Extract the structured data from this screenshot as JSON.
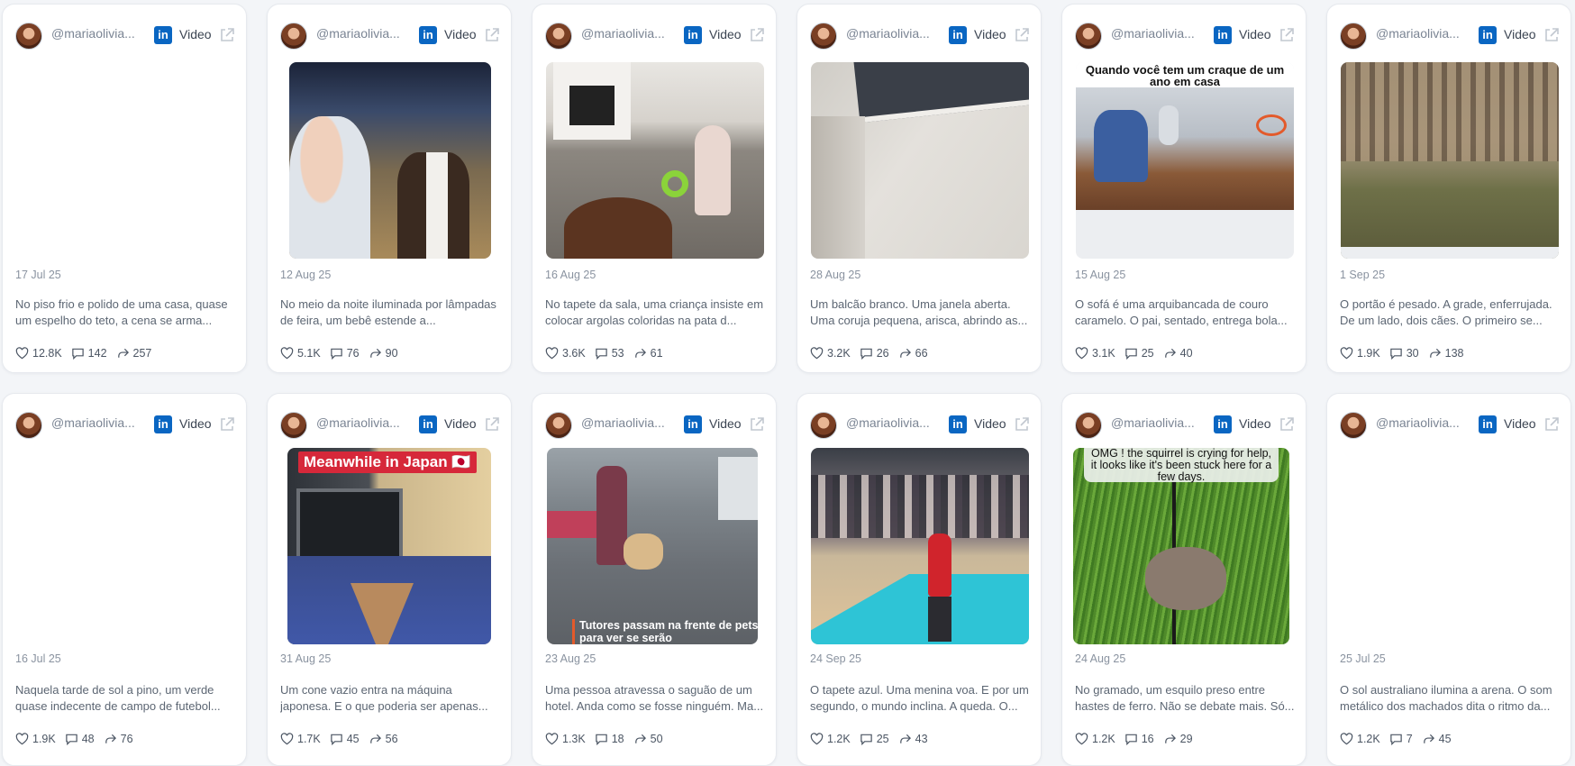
{
  "cards": [
    {
      "handle": "@mariaolivia...",
      "network": "in",
      "kind": "Video",
      "date": "17 Jul 25",
      "desc": "No piso frio e polido de uma casa, quase um espelho do teto, a cena se arma...",
      "likes": "12.8K",
      "comments": "142",
      "shares": "257"
    },
    {
      "handle": "@mariaolivia...",
      "network": "in",
      "kind": "Video",
      "date": "12 Aug 25",
      "desc": "No meio da noite iluminada por lâmpadas de feira, um bebê estende a...",
      "likes": "5.1K",
      "comments": "76",
      "shares": "90"
    },
    {
      "handle": "@mariaolivia...",
      "network": "in",
      "kind": "Video",
      "date": "16 Aug 25",
      "desc": "No tapete da sala, uma criança insiste em colocar argolas coloridas na pata d...",
      "likes": "3.6K",
      "comments": "53",
      "shares": "61"
    },
    {
      "handle": "@mariaolivia...",
      "network": "in",
      "kind": "Video",
      "date": "28 Aug 25",
      "desc": "Um balcão branco. Uma janela aberta. Uma coruja pequena, arisca, abrindo as...",
      "likes": "3.2K",
      "comments": "26",
      "shares": "66"
    },
    {
      "handle": "@mariaolivia...",
      "network": "in",
      "kind": "Video",
      "date": "15 Aug 25",
      "desc": "O sofá é uma arquibancada de couro caramelo. O pai, sentado, entrega bola...",
      "likes": "3.1K",
      "comments": "25",
      "shares": "40",
      "overlay": "Quando você tem um craque de um ano em casa"
    },
    {
      "handle": "@mariaolivia...",
      "network": "in",
      "kind": "Video",
      "date": "1 Sep 25",
      "desc": "O portão é pesado. A grade, enferrujada. De um lado, dois cães. O primeiro se...",
      "likes": "1.9K",
      "comments": "30",
      "shares": "138"
    },
    {
      "handle": "@mariaolivia...",
      "network": "in",
      "kind": "Video",
      "date": "16 Jul 25",
      "desc": "Naquela tarde de sol a pino, um verde quase indecente de campo de futebol...",
      "likes": "1.9K",
      "comments": "48",
      "shares": "76"
    },
    {
      "handle": "@mariaolivia...",
      "network": "in",
      "kind": "Video",
      "date": "31 Aug 25",
      "desc": "Um cone vazio entra na máquina japonesa. E o que poderia ser apenas...",
      "likes": "1.7K",
      "comments": "45",
      "shares": "56",
      "overlay": "Meanwhile in Japan 🇯🇵"
    },
    {
      "handle": "@mariaolivia...",
      "network": "in",
      "kind": "Video",
      "date": "23 Aug 25",
      "desc": "Uma pessoa atravessa o saguão de um hotel. Anda como se fosse ninguém. Ma...",
      "likes": "1.3K",
      "comments": "18",
      "shares": "50",
      "overlay": "Tutores passam na frente de pets para ver se serão"
    },
    {
      "handle": "@mariaolivia...",
      "network": "in",
      "kind": "Video",
      "date": "24 Sep 25",
      "desc": "O tapete azul. Uma menina voa. E por um segundo, o mundo inclina. A queda. O...",
      "likes": "1.2K",
      "comments": "25",
      "shares": "43"
    },
    {
      "handle": "@mariaolivia...",
      "network": "in",
      "kind": "Video",
      "date": "24 Aug 25",
      "desc": "No gramado, um esquilo preso entre hastes de ferro. Não se debate mais. Só...",
      "likes": "1.2K",
      "comments": "16",
      "shares": "29",
      "overlay": "OMG ! the squirrel is crying for help, it looks like it's been stuck here for a few days."
    },
    {
      "handle": "@mariaolivia...",
      "network": "in",
      "kind": "Video",
      "date": "25 Jul 25",
      "desc": "O sol australiano ilumina a arena. O som metálico dos machados dita o ritmo da...",
      "likes": "1.2K",
      "comments": "7",
      "shares": "45"
    }
  ],
  "colors": {
    "linkedin": "#0a66c2",
    "accent_teal": "#2ec4d6",
    "text_muted": "#8a93a0"
  },
  "icons": {
    "like": "heart-icon",
    "comment": "comment-icon",
    "share": "share-icon",
    "external": "external-link-icon",
    "network": "linkedin-icon"
  }
}
